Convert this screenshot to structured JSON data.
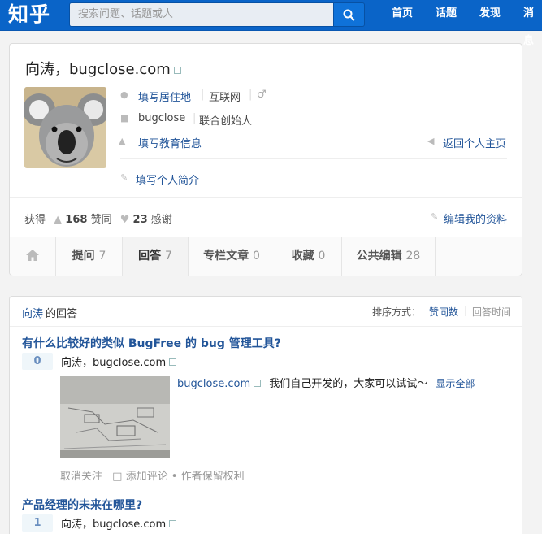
{
  "topbar": {
    "logo": "知乎",
    "search_placeholder": "搜索问题、话题或人",
    "nav": [
      "首页",
      "话题",
      "发现",
      "消息"
    ]
  },
  "profile": {
    "name": "向涛，bugclose.com",
    "location": "填写居住地",
    "industry": "互联网",
    "gender_icon": "male-symbol",
    "company": "bugclose",
    "position": "联合创始人",
    "education": "填写教育信息",
    "back_home": "返回个人主页",
    "bio_prompt": "填写个人简介",
    "stats_prefix": "获得",
    "agree_count": "168",
    "agree_label": "赞同",
    "thanks_count": "23",
    "thanks_label": "感谢",
    "edit_profile": "编辑我的资料",
    "tabs": [
      {
        "label": "提问",
        "count": "7"
      },
      {
        "label": "回答",
        "count": "7"
      },
      {
        "label": "专栏文章",
        "count": "0"
      },
      {
        "label": "收藏",
        "count": "0"
      },
      {
        "label": "公共编辑",
        "count": "28"
      }
    ]
  },
  "answers": {
    "owner": "向涛",
    "owner_suffix": " 的回答",
    "sort_label": "排序方式：",
    "sort_votes": "赞同数",
    "sort_time": "回答时间",
    "items": [
      {
        "question": "有什么比较好的类似 BugFree 的 bug 管理工具?",
        "votes": "0",
        "author": "向涛，bugclose.com",
        "link_text": "bugclose.com",
        "excerpt": "我们自己开发的，大家可以试试～",
        "show_all": "显示全部",
        "actions": {
          "unfollow": "取消关注",
          "comment": "添加评论",
          "rights": "作者保留权利"
        }
      },
      {
        "question": "产品经理的未来在哪里?",
        "votes": "1",
        "author": "向涛，bugclose.com"
      }
    ]
  }
}
